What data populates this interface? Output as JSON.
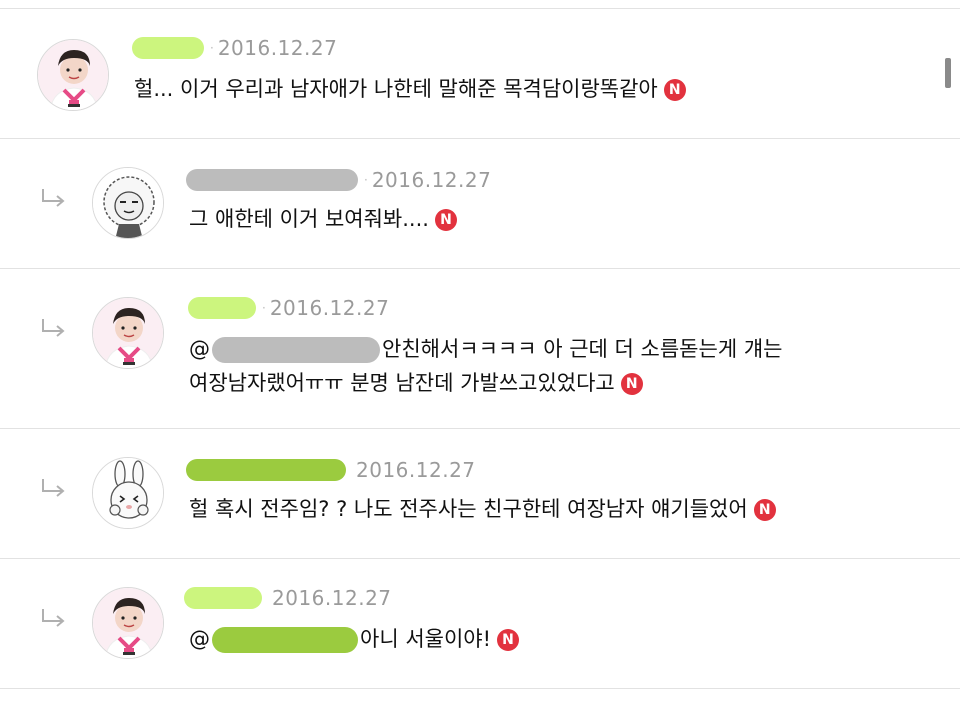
{
  "comments": [
    {
      "date": "2016.12.27",
      "text": "헐... 이거 우리과 남자애가 나한테 말해준 목격담이랑똑같아",
      "badge": "N",
      "avatar": "person-avatar"
    },
    {
      "date": "2016.12.27",
      "text": "그 애한테 이거 보여줘봐....",
      "badge": "N",
      "avatar": "cartoon-lion-avatar"
    },
    {
      "date": "2016.12.27",
      "mention": "@",
      "line1": "안친해서ㅋㅋㅋㅋ 아 근데 더 소름돋는게 걔는",
      "line2": "여장남자랬어ㅠㅠ 분명 남잔데 가발쓰고있었다고",
      "badge": "N",
      "avatar": "person-avatar"
    },
    {
      "date": "2016.12.27",
      "text": "헐 혹시 전주임? ? 나도 전주사는 친구한테 여장남자 얘기들었어",
      "badge": "N",
      "avatar": "cartoon-rabbit-avatar"
    },
    {
      "date": "2016.12.27",
      "mention": "@",
      "text": "아니 서울이야!",
      "badge": "N",
      "avatar": "person-avatar"
    }
  ],
  "colors": {
    "badge": "#e2323e",
    "date": "#9a9a9a",
    "divider": "#e2e2e2",
    "mask_lime": "#ccf57e",
    "mask_green": "#9bcb3f",
    "mask_gray": "#bcbcbc"
  }
}
